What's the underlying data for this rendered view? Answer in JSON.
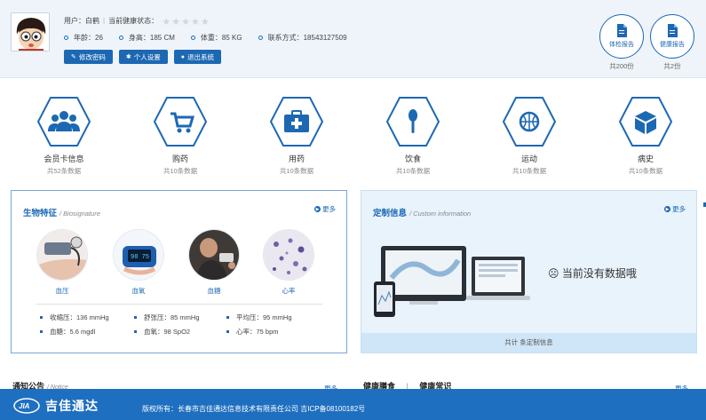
{
  "user": {
    "user_label": "用户：",
    "user_name": "白鹤",
    "health_label": "当前健康状态：",
    "rating": 0,
    "rating_max": 5,
    "stats": [
      {
        "label": "年龄：",
        "value": "26"
      },
      {
        "label": "身高：",
        "value": "185 CM"
      },
      {
        "label": "体重：",
        "value": "85 KG"
      },
      {
        "label": "联系方式：",
        "value": "18543127509"
      }
    ],
    "buttons": [
      {
        "icon": "edit-icon",
        "label": "修改密码"
      },
      {
        "icon": "gear-icon",
        "label": "个人设置"
      },
      {
        "icon": "logout-icon",
        "label": "退出系统"
      }
    ]
  },
  "reports": [
    {
      "icon": "document-icon",
      "label": "体检报告",
      "count": "共200份"
    },
    {
      "icon": "document-icon",
      "label": "健康报告",
      "count": "共2份"
    }
  ],
  "categories": [
    {
      "icon": "users-icon",
      "name": "会员卡信息",
      "sub": "共52条数据"
    },
    {
      "icon": "cart-icon",
      "name": "购药",
      "sub": "共10条数据"
    },
    {
      "icon": "medkit-icon",
      "name": "用药",
      "sub": "共10条数据"
    },
    {
      "icon": "spoon-icon",
      "name": "饮食",
      "sub": "共10条数据"
    },
    {
      "icon": "basketball-icon",
      "name": "运动",
      "sub": "共10条数据"
    },
    {
      "icon": "cube-icon",
      "name": "病史",
      "sub": "共10条数据"
    }
  ],
  "bio": {
    "title": "生物特征",
    "title_en": "/ Biosignature",
    "more": "更多",
    "items": [
      {
        "label": "血压"
      },
      {
        "label": "血氧"
      },
      {
        "label": "血糖"
      },
      {
        "label": "心率"
      }
    ],
    "metrics": [
      {
        "label": "收缩压：",
        "value": "136 mmHg"
      },
      {
        "label": "舒张压：",
        "value": "85 mmHg"
      },
      {
        "label": "平均压：",
        "value": "95 mmHg"
      },
      {
        "label": "血糖：",
        "value": "5.6 mgdl"
      },
      {
        "label": "血氧：",
        "value": "98 SpO2"
      },
      {
        "label": "心率：",
        "value": "75 bpm"
      }
    ]
  },
  "custom": {
    "title": "定制信息",
    "title_en": "/ Custom information",
    "more": "更多",
    "empty": "当前没有数据哦",
    "footer": "共计  条定制信息"
  },
  "notice": {
    "title": "通知公告",
    "title_en": "/ Notice",
    "more": "更多"
  },
  "health": {
    "tab1": "健康膳食",
    "sep": "|",
    "tab2": "健康常识",
    "more": "更多"
  },
  "footer": {
    "brand": "吉佳通达",
    "logo_text": "JIA",
    "copyright": "版权所有：长春市吉佳通达信息技术有限责任公司 吉ICP备08100182号"
  },
  "colors": {
    "accent": "#1d68b3",
    "footer": "#1e6fc0",
    "header_bg": "#eef4fa"
  }
}
